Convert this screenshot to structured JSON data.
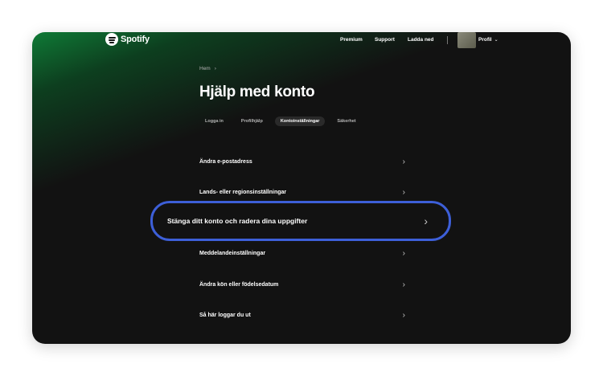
{
  "nav": {
    "brand": "Spotify",
    "links": [
      "Premium",
      "Support",
      "Ladda ned"
    ],
    "profile_label": "Profil",
    "profile_caret": "⌄"
  },
  "breadcrumb": {
    "home": "Hem",
    "sep": "›"
  },
  "page": {
    "title": "Hjälp med konto"
  },
  "tabs": [
    {
      "label": "Logga in",
      "active": false
    },
    {
      "label": "Profilhjälp",
      "active": false
    },
    {
      "label": "Kontoinställningar",
      "active": true
    },
    {
      "label": "Säkerhet",
      "active": false
    }
  ],
  "items": [
    {
      "label": "Ändra e-postadress"
    },
    {
      "label": "Lands- eller regionsinställningar"
    },
    {
      "label": "Stänga ditt konto och radera dina uppgifter",
      "highlighted": true
    },
    {
      "label": "Meddelandeinställningar"
    },
    {
      "label": "Ändra kön eller födelsedatum"
    },
    {
      "label": "Så här loggar du ut"
    }
  ],
  "chevron_glyph": "›",
  "colors": {
    "accent_green": "#1db954",
    "highlight_border": "#3d5fd8",
    "background": "#121212"
  }
}
